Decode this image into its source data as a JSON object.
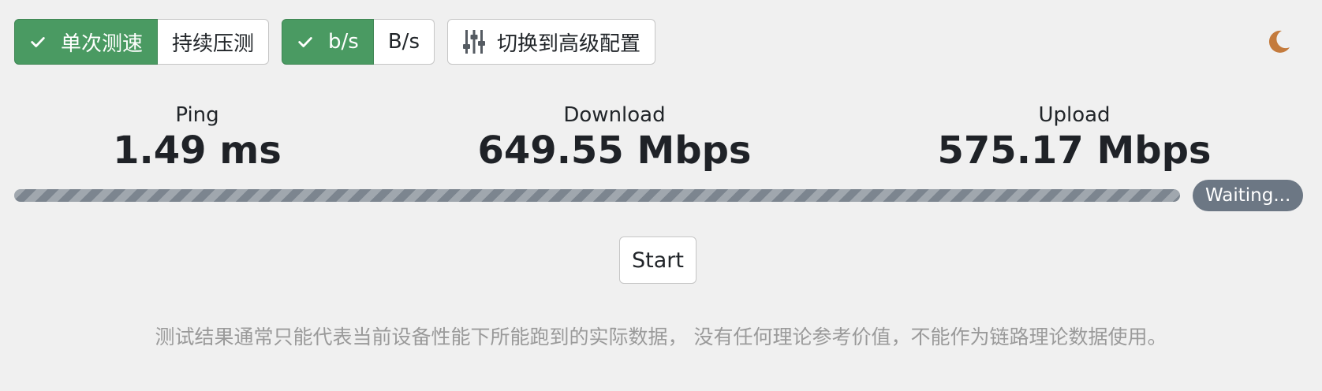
{
  "toolbar": {
    "mode_group": {
      "single_label": "单次测速",
      "continuous_label": "持续压测"
    },
    "unit_group": {
      "bits_label": "b/s",
      "bytes_label": "B/s"
    },
    "advanced_label": "切换到高级配置"
  },
  "icons": {
    "check": "check-icon",
    "sliders": "sliders-icon",
    "theme": "moon-icon"
  },
  "colors": {
    "active_button": "#4a9a62",
    "progress_track": "#9aa1a9",
    "badge": "#6c7784",
    "moon": "#c47b3d"
  },
  "metrics": {
    "ping": {
      "label": "Ping",
      "value": "1.49 ms"
    },
    "download": {
      "label": "Download",
      "value": "649.55 Mbps"
    },
    "upload": {
      "label": "Upload",
      "value": "575.17 Mbps"
    }
  },
  "progress": {
    "percent": 100,
    "status": "Waiting..."
  },
  "start_label": "Start",
  "disclaimer": "测试结果通常只能代表当前设备性能下所能跑到的实际数据， 没有任何理论参考价值，不能作为链路理论数据使用。"
}
